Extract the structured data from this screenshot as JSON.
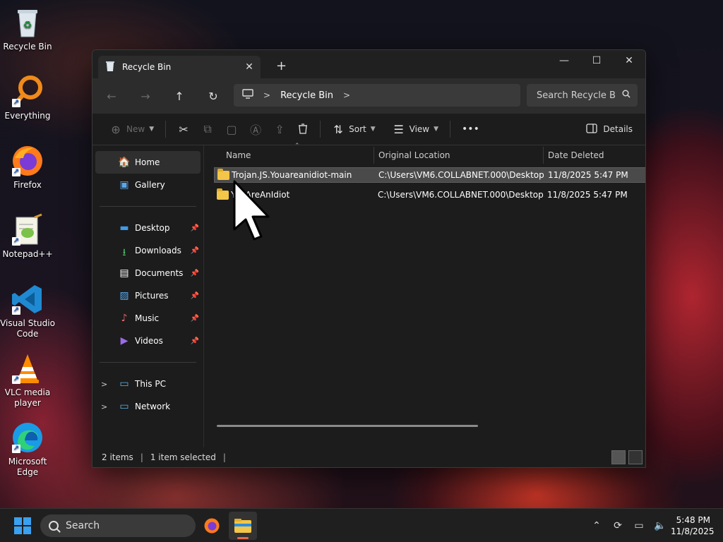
{
  "desktop": {
    "icons": [
      {
        "label": "Recycle Bin"
      },
      {
        "label": "Everything"
      },
      {
        "label": "Firefox"
      },
      {
        "label": "Notepad++"
      },
      {
        "label": "Visual Studio Code"
      },
      {
        "label": "VLC media player"
      },
      {
        "label": "Microsoft Edge"
      }
    ]
  },
  "window": {
    "tab_title": "Recycle Bin",
    "address": {
      "location": "Recycle Bin"
    },
    "search": {
      "placeholder": "Search Recycle B"
    },
    "toolbar": {
      "new_label": "New",
      "sort_label": "Sort",
      "view_label": "View",
      "more_label": "•••",
      "details_label": "Details"
    },
    "nav": {
      "top": [
        {
          "label": "Home"
        },
        {
          "label": "Gallery"
        }
      ],
      "pinned": [
        {
          "label": "Desktop"
        },
        {
          "label": "Downloads"
        },
        {
          "label": "Documents"
        },
        {
          "label": "Pictures"
        },
        {
          "label": "Music"
        },
        {
          "label": "Videos"
        }
      ],
      "bottom": [
        {
          "label": "This PC"
        },
        {
          "label": "Network"
        }
      ]
    },
    "columns": {
      "name": "Name",
      "location": "Original Location",
      "date": "Date Deleted"
    },
    "rows": [
      {
        "name": "Trojan.JS.Youareanidiot-main",
        "location": "C:\\Users\\VM6.COLLABNET.000\\Desktop",
        "date": "11/8/2025 5:47 PM",
        "selected": true
      },
      {
        "name": "YouAreAnIdiot",
        "location": "C:\\Users\\VM6.COLLABNET.000\\Desktop",
        "date": "11/8/2025 5:47 PM",
        "selected": false
      }
    ],
    "status": {
      "items": "2 items",
      "selected": "1 item selected"
    }
  },
  "taskbar": {
    "search_label": "Search",
    "time": "5:48 PM",
    "date": "11/8/2025"
  },
  "colors": {
    "accent": "#3aa0f0",
    "folder": "#f3c548",
    "window_bg": "#1c1c1c"
  }
}
